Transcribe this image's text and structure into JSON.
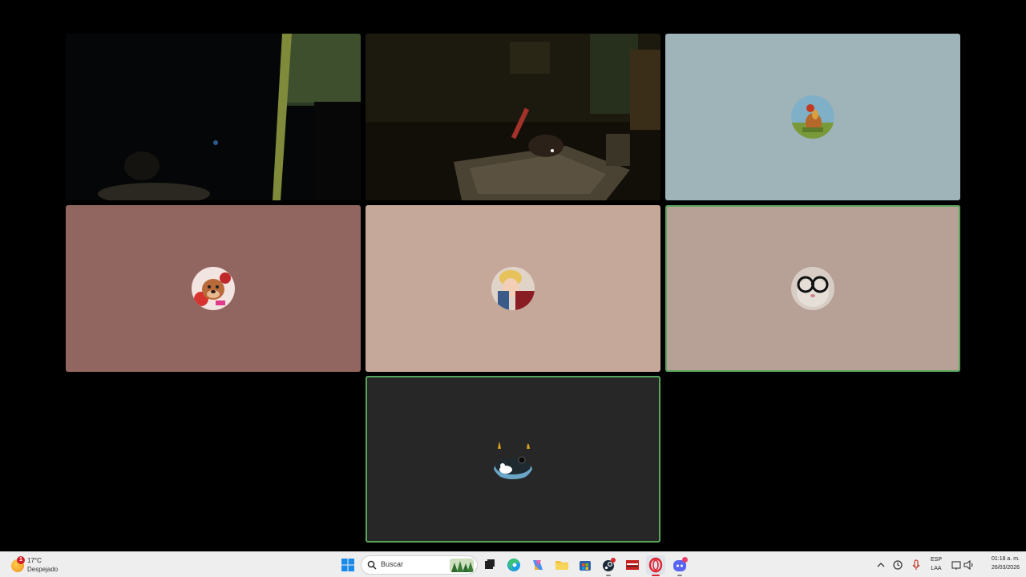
{
  "meeting": {
    "participants": [
      {
        "id": "p1",
        "kind": "camera",
        "scene": "dark-room-left"
      },
      {
        "id": "p2",
        "kind": "camera",
        "scene": "dark-room-bed"
      },
      {
        "id": "p3",
        "kind": "avatar",
        "bg": "#9fb4b8",
        "avatar_icon": "rooster-avatar-icon"
      },
      {
        "id": "p4",
        "kind": "avatar",
        "bg": "#926660",
        "avatar_icon": "dog-avatar-icon"
      },
      {
        "id": "p5",
        "kind": "avatar",
        "bg": "#c6a89a",
        "avatar_icon": "anime-avatar-icon"
      },
      {
        "id": "p6",
        "kind": "avatar",
        "bg": "#b7a095",
        "avatar_icon": "cat-glasses-avatar-icon",
        "speaking": true
      },
      {
        "id": "p7",
        "kind": "avatar",
        "bg": "#272727",
        "avatar_icon": "duck-avatar-icon",
        "speaking": true
      }
    ],
    "speaking_color": "#58a65c"
  },
  "taskbar": {
    "weather": {
      "temp": "17°C",
      "condition": "Despejado",
      "alert_count": "1"
    },
    "search_placeholder": "Buscar",
    "pinned": [
      "windows-start-icon",
      "task-view-icon",
      "edge-browser-icon",
      "copilot-icon",
      "file-explorer-icon",
      "store-icon",
      "steam-icon",
      "video-app-icon",
      "opera-browser-icon",
      "discord-icon"
    ],
    "tray": {
      "language": "ESP",
      "layout": "LAA",
      "time": "01:18 a. m.",
      "date": "26/03/2026"
    }
  }
}
